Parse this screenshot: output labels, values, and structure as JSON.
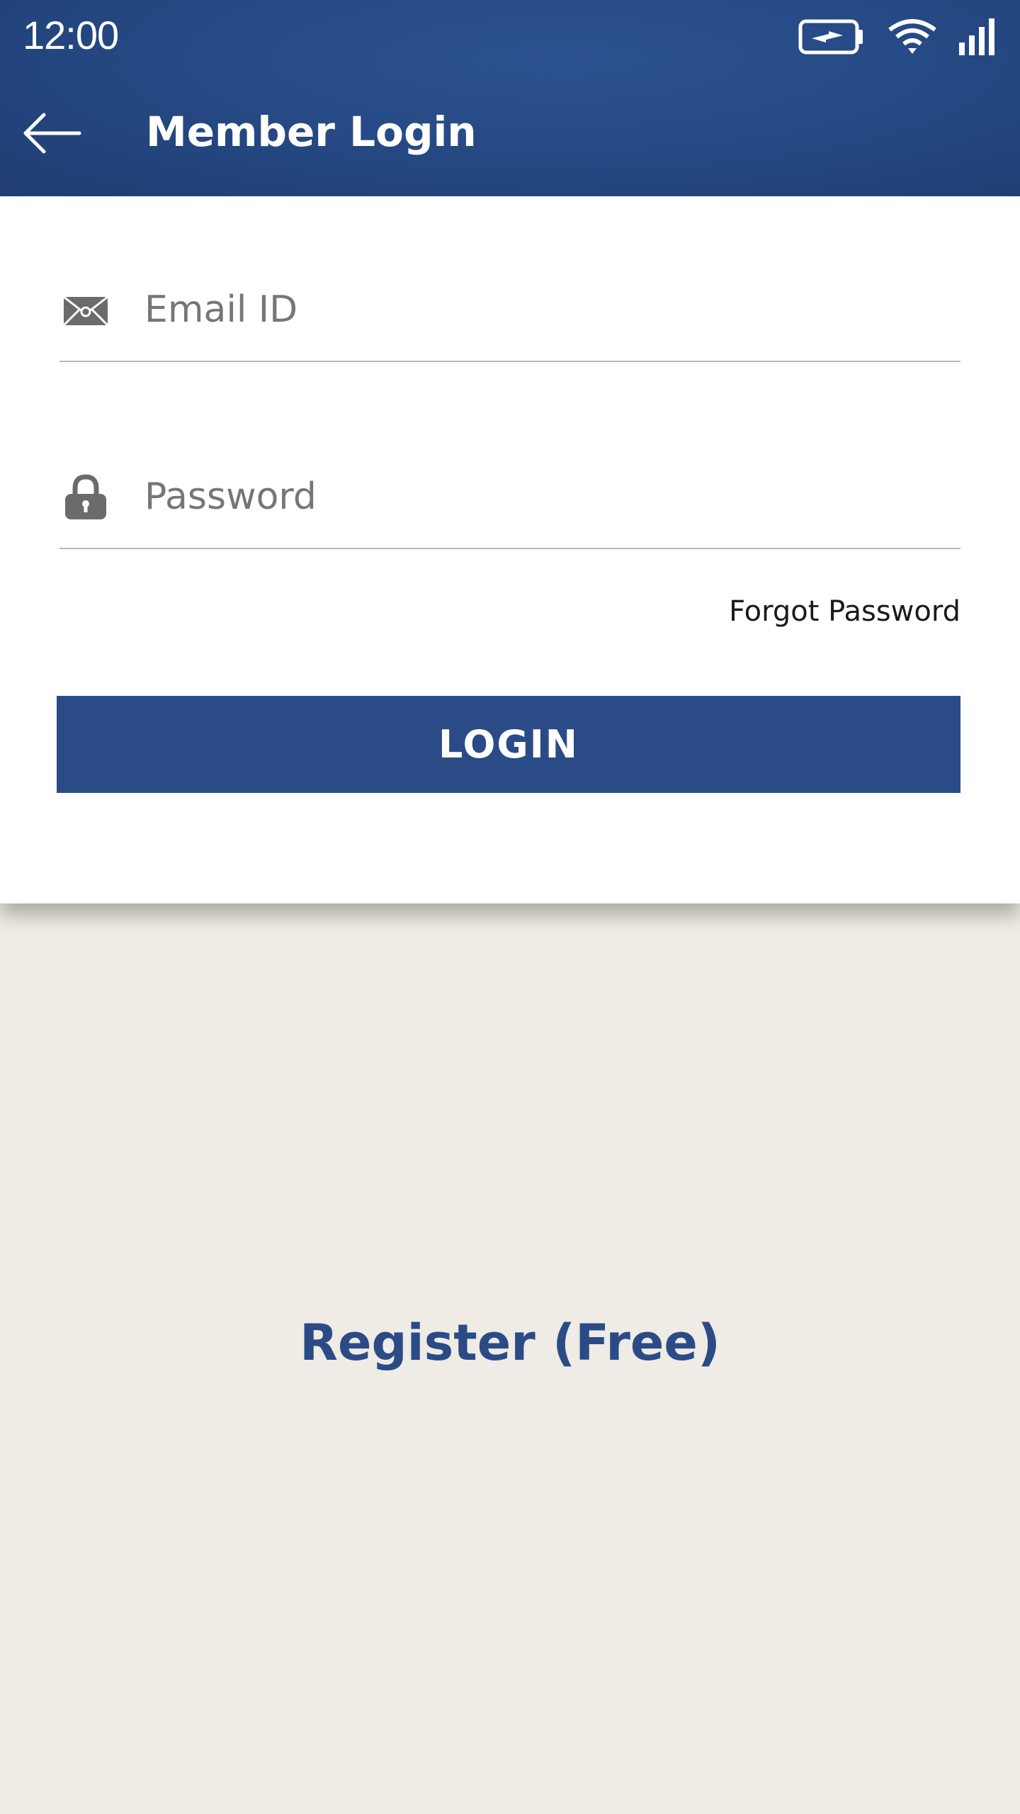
{
  "status_bar": {
    "time": "12:00",
    "icons": [
      "battery-charging-icon",
      "wifi-icon",
      "cell-signal-icon"
    ]
  },
  "header": {
    "back_icon": "arrow-left-icon",
    "title": "Member Login"
  },
  "form": {
    "email": {
      "icon": "envelope-icon",
      "placeholder": "Email ID",
      "value": ""
    },
    "password": {
      "icon": "lock-icon",
      "placeholder": "Password",
      "value": ""
    },
    "forgot_label": "Forgot Password",
    "login_label": "LOGIN"
  },
  "register_label": "Register (Free)",
  "colors": {
    "header": "#264a85",
    "accent": "#2b4b87",
    "background": "#efebe5",
    "card": "#ffffff",
    "icon_gray": "#6b6b6b"
  }
}
